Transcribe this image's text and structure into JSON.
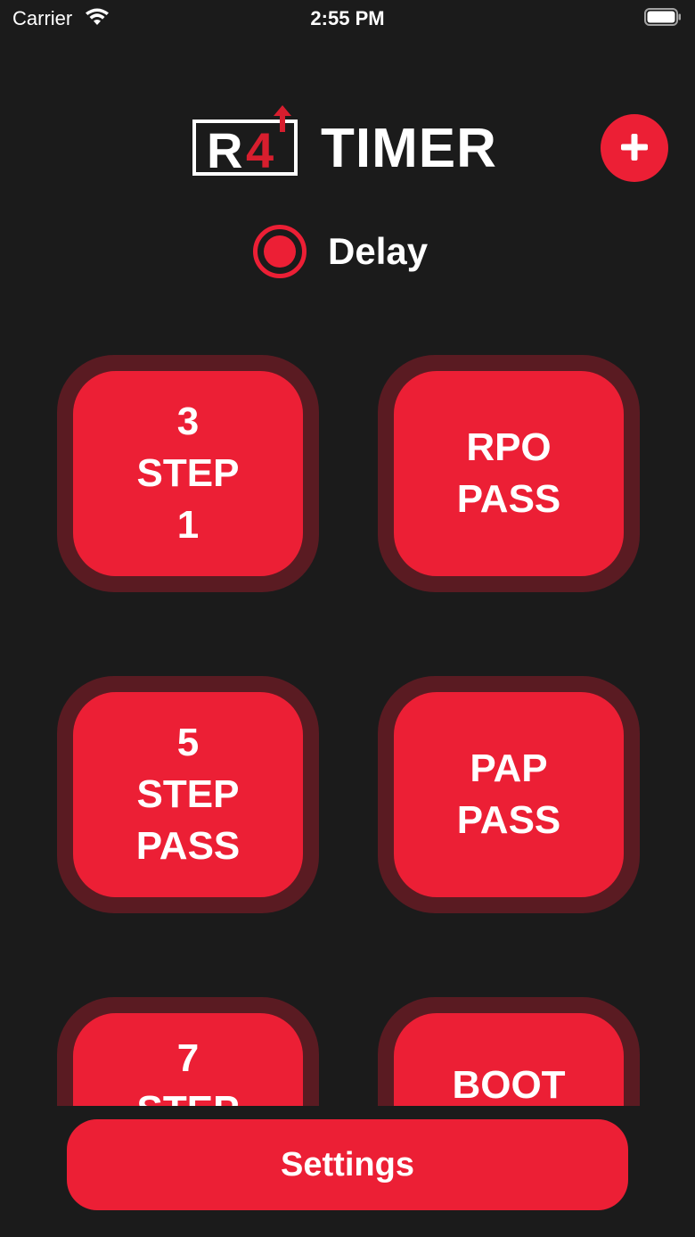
{
  "status_bar": {
    "carrier": "Carrier",
    "time": "2:55 PM"
  },
  "header": {
    "logo_mark_r": "R",
    "logo_mark_4": "4",
    "logo_text": "TIMER",
    "add_icon": "plus-icon"
  },
  "delay": {
    "label": "Delay",
    "selected": true
  },
  "tiles": [
    {
      "lines": [
        "3",
        "STEP",
        "1"
      ]
    },
    {
      "lines": [
        "RPO",
        "PASS"
      ]
    },
    {
      "lines": [
        "5",
        "STEP",
        "PASS"
      ]
    },
    {
      "lines": [
        "PAP",
        "PASS"
      ]
    },
    {
      "lines": [
        "7",
        "STEP"
      ]
    },
    {
      "lines": [
        "BOOT"
      ]
    }
  ],
  "settings": {
    "label": "Settings"
  },
  "colors": {
    "background": "#1b1b1b",
    "accent": "#ec1f35",
    "tile_ring": "#5a1b22",
    "logo_red": "#d71e2e"
  }
}
